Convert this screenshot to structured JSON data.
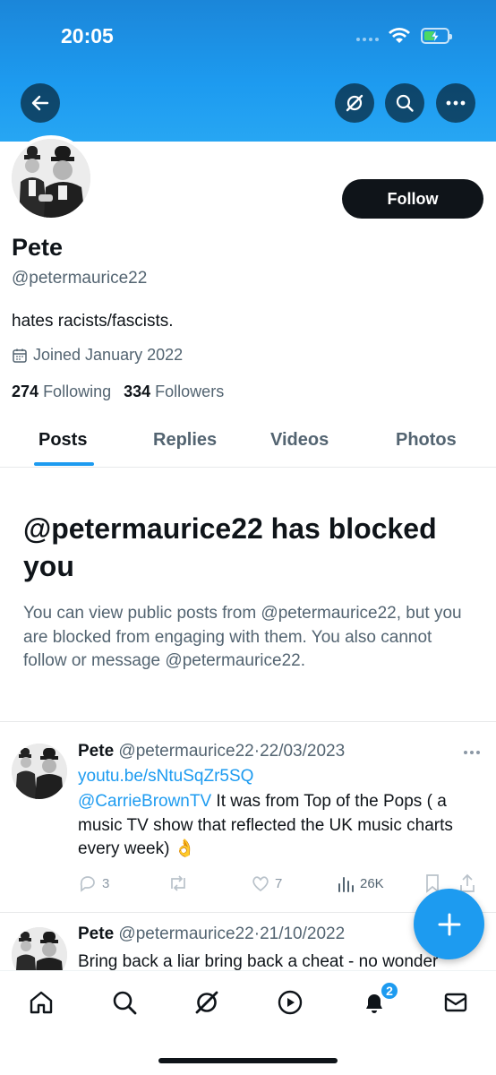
{
  "status_bar": {
    "time": "20:05"
  },
  "header": {
    "back_icon": "arrow-left-icon",
    "grok_icon": "grok-icon",
    "search_icon": "search-icon",
    "more_icon": "more-horizontal-icon"
  },
  "profile": {
    "name": "Pete",
    "handle": "@petermaurice22",
    "bio": "hates racists/fascists.",
    "joined": "Joined January 2022",
    "following_count": "274",
    "following_label": "Following",
    "followers_count": "334",
    "followers_label": "Followers",
    "follow_label": "Follow"
  },
  "tabs": [
    {
      "label": "Posts",
      "active": true
    },
    {
      "label": "Replies"
    },
    {
      "label": "Videos"
    },
    {
      "label": "Photos"
    }
  ],
  "blocked": {
    "title": "@petermaurice22 has blocked you",
    "description": "You can view public posts from @petermaurice22, but you are blocked from engaging with them. You also cannot follow or message @petermaurice22."
  },
  "posts": [
    {
      "name": "Pete",
      "handle": "@petermaurice22",
      "date": "22/03/2023",
      "link": "youtu.be/sNtuSqZr5SQ",
      "mention": "@CarrieBrownTV",
      "text": " It was from Top of the Pops ( a music TV show that reflected the UK music charts every week) 👌",
      "replies": "3",
      "likes": "7",
      "views": "26K"
    },
    {
      "name": "Pete",
      "handle": "@petermaurice22",
      "date": "21/10/2022",
      "text": "Bring back a liar bring back a cheat  - no wonder"
    }
  ],
  "bottom_nav": {
    "notifications_badge": "2"
  },
  "colors": {
    "accent": "#1d9bf0",
    "text": "#0f1419",
    "muted": "#536471"
  }
}
